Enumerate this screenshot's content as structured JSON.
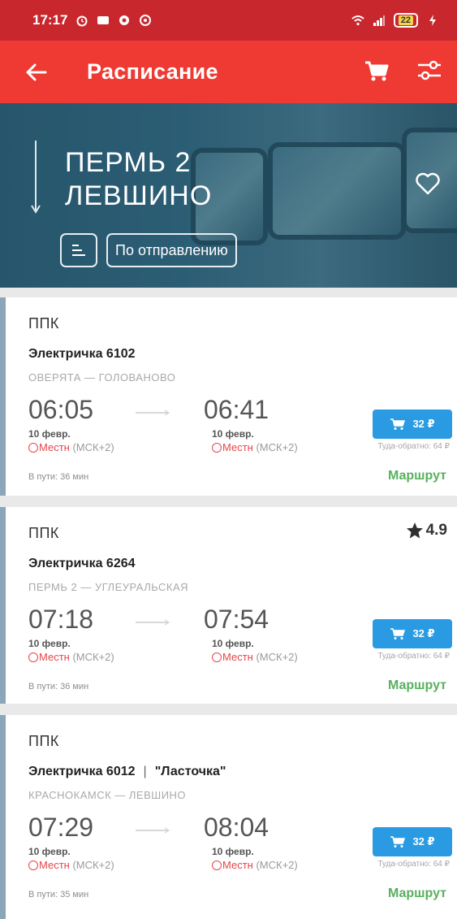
{
  "status_bar": {
    "time": "17:17",
    "battery": "22"
  },
  "app_bar": {
    "title": "Расписание"
  },
  "hero": {
    "from": "ПЕРМЬ 2",
    "to": "ЛЕВШИНО",
    "sort_mode": "По отправлению"
  },
  "trains": [
    {
      "type": "ППК",
      "name": "Электричка 6102",
      "branding": "",
      "route": "ОВЕРЯТА — ГОЛОВАНОВО",
      "departure_time": "06:05",
      "departure_date": "10 февр.",
      "arrival_time": "06:41",
      "arrival_date": "10 февр.",
      "seats_label": "Местн",
      "timezone": "(МСК+2)",
      "price": "32 ₽",
      "roundtrip": "Туда-обратно: 64 ₽",
      "duration": "В пути: 36 мин",
      "route_link": "Маршрут",
      "rating": ""
    },
    {
      "type": "ППК",
      "name": "Электричка 6264",
      "branding": "",
      "route": "ПЕРМЬ 2 — УГЛЕУРАЛЬСКАЯ",
      "departure_time": "07:18",
      "departure_date": "10 февр.",
      "arrival_time": "07:54",
      "arrival_date": "10 февр.",
      "seats_label": "Местн",
      "timezone": "(МСК+2)",
      "price": "32 ₽",
      "roundtrip": "Туда-обратно: 64 ₽",
      "duration": "В пути: 36 мин",
      "route_link": "Маршрут",
      "rating": "4.9"
    },
    {
      "type": "ППК",
      "name": "Электричка 6012",
      "branding": "\"Ласточка\"",
      "route": "КРАСНОКАМСК — ЛЕВШИНО",
      "departure_time": "07:29",
      "departure_date": "10 февр.",
      "arrival_time": "08:04",
      "arrival_date": "10 февр.",
      "seats_label": "Местн",
      "timezone": "(МСК+2)",
      "price": "32 ₽",
      "roundtrip": "Туда-обратно: 64 ₽",
      "duration": "В пути: 35 мин",
      "route_link": "Маршрут",
      "rating": ""
    }
  ],
  "colors": {
    "status_bar": "#c8272d",
    "app_bar": "#ee3a33",
    "hero": "#2b5d74",
    "price_button": "#2a9be3",
    "route_link": "#58b05d",
    "seats_red": "#e6464b"
  }
}
